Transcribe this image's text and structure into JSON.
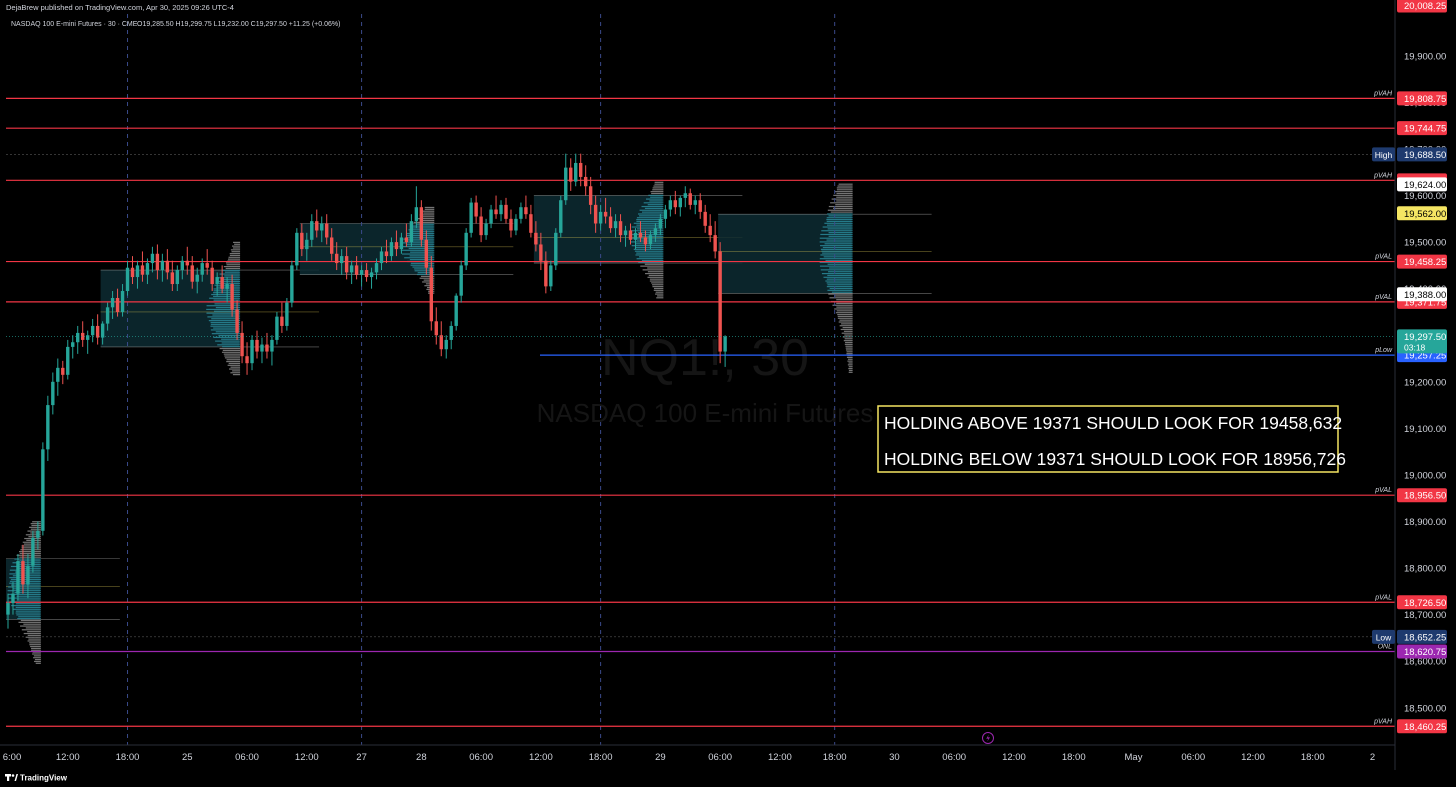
{
  "header": {
    "published_by": "DejaBrew published on TradingView.com, Apr 30, 2025 09:26 UTC-4",
    "symbol_line": "NASDAQ 100 E-mini Futures · 30 · CME",
    "ohlc": "O19,285.50  H19,299.75  L19,232.00  C19,297.50  +11.25 (+0.06%)"
  },
  "watermark": {
    "symbol": "NQ1!, 30",
    "name": "NASDAQ 100 E-mini Futures"
  },
  "annotation": {
    "line1": "HOLDING ABOVE 19371 SHOULD LOOK FOR 19458,632",
    "line2": "HOLDING BELOW 19371 SHOULD LOOK FOR 18956,726"
  },
  "footer": {
    "brand": "TradingView",
    "brand_icon": "tradingview-logo-icon"
  },
  "colors": {
    "background": "#000000",
    "level_red": "#f23645",
    "level_blue": "#2962ff",
    "level_purple": "#9c27b0",
    "candle_up": "#26a69a",
    "candle_down": "#ef5350",
    "profile_box": "#0d2b33",
    "annotation_border": "#f5e663",
    "last_price": "#26a69a"
  },
  "chart_data": {
    "type": "candlestick",
    "title": "NASDAQ 100 E-mini Futures · 30 · CME",
    "ylim": [
      18420,
      20020
    ],
    "y_ticks": [
      18500,
      18600,
      18700,
      18800,
      18900,
      19000,
      19100,
      19200,
      19300,
      19400,
      19500,
      19600,
      19700,
      19800,
      19900
    ],
    "y_tick_labels": [
      "18,500.00",
      "18,600.00",
      "18,700.00",
      "18,800.00",
      "18,900.00",
      "19,000.00",
      "19,100.00",
      "19,200.00",
      "19,300.00",
      "19,400.00",
      "19,500.00",
      "19,600.00",
      "19,700.00",
      "19,800.00",
      "19,900.00"
    ],
    "x_ticks": [
      {
        "label": "6:00",
        "bar": 0
      },
      {
        "label": "12:00",
        "bar": 12
      },
      {
        "label": "18:00",
        "bar": 24
      },
      {
        "label": "25",
        "bar": 36
      },
      {
        "label": "06:00",
        "bar": 48
      },
      {
        "label": "12:00",
        "bar": 60
      },
      {
        "label": "27",
        "bar": 71
      },
      {
        "label": "28",
        "bar": 83
      },
      {
        "label": "06:00",
        "bar": 95
      },
      {
        "label": "12:00",
        "bar": 107
      },
      {
        "label": "18:00",
        "bar": 119
      },
      {
        "label": "29",
        "bar": 131
      },
      {
        "label": "06:00",
        "bar": 143
      },
      {
        "label": "12:00",
        "bar": 155
      },
      {
        "label": "18:00",
        "bar": 166
      },
      {
        "label": "30",
        "bar": 178
      },
      {
        "label": "06:00",
        "bar": 190
      },
      {
        "label": "12:00",
        "bar": 202
      },
      {
        "label": "18:00",
        "bar": 214
      },
      {
        "label": "May",
        "bar": 226
      },
      {
        "label": "06:00",
        "bar": 238
      },
      {
        "label": "12:00",
        "bar": 250
      },
      {
        "label": "18:00",
        "bar": 262
      },
      {
        "label": "2",
        "bar": 274
      }
    ],
    "session_separators": [
      24,
      71,
      119,
      166
    ],
    "levels": [
      {
        "price": 19808.75,
        "label": "19,808.75",
        "tag": "pVAH",
        "kind": "red"
      },
      {
        "price": 19744.75,
        "label": "19,744.75",
        "tag": "",
        "kind": "red"
      },
      {
        "price": 19632.75,
        "label": "19,632.75",
        "tag": "pVAH",
        "kind": "red"
      },
      {
        "price": 19458.25,
        "label": "19,458.25",
        "tag": "pVAL",
        "kind": "red"
      },
      {
        "price": 19371.75,
        "label": "19,371.75",
        "tag": "pVAL",
        "kind": "red"
      },
      {
        "price": 19257.25,
        "label": "19,257.25",
        "tag": "pLow",
        "kind": "blue"
      },
      {
        "price": 18956.5,
        "label": "18,956.50",
        "tag": "pVAL",
        "kind": "red"
      },
      {
        "price": 18726.5,
        "label": "18,726.50",
        "tag": "pVAL",
        "kind": "red"
      },
      {
        "price": 18620.75,
        "label": "18,620.75",
        "tag": "ONL",
        "kind": "purple"
      },
      {
        "price": 18460.25,
        "label": "18,460.25",
        "tag": "pVAH",
        "kind": "red"
      }
    ],
    "price_tags": [
      {
        "price": 20008.25,
        "label": "20,008.25",
        "kind": "red"
      },
      {
        "price": 19688.5,
        "label": "19,688.50",
        "kind": "navy",
        "side_label": "High"
      },
      {
        "price": 19624.0,
        "label": "19,624.00",
        "kind": "white"
      },
      {
        "price": 19562.0,
        "label": "19,562.00",
        "kind": "yellow"
      },
      {
        "price": 19388.0,
        "label": "19,388.00",
        "kind": "white"
      },
      {
        "price": 18652.25,
        "label": "18,652.25",
        "kind": "navy",
        "side_label": "Low"
      }
    ],
    "last_price": {
      "price": 19297.5,
      "label": "19,297.50",
      "countdown": "03:18"
    },
    "profiles": [
      {
        "start": 0,
        "end": 6,
        "high": 18900,
        "low": 18595,
        "vah": 18820,
        "poc": 18760,
        "val": 18690
      },
      {
        "start": 19,
        "end": 46,
        "high": 19500,
        "low": 19215,
        "vah": 19440,
        "poc": 19350,
        "val": 19275
      },
      {
        "start": 59,
        "end": 85,
        "high": 19575,
        "low": 19390,
        "vah": 19540,
        "poc": 19490,
        "val": 19430
      },
      {
        "start": 106,
        "end": 131,
        "high": 19630,
        "low": 19380,
        "vah": 19600,
        "poc": 19510,
        "val": 19455
      },
      {
        "start": 143,
        "end": 169,
        "high": 19625,
        "low": 19220,
        "vah": 19560,
        "poc": 19480,
        "val": 19390
      }
    ],
    "candles": [
      [
        18700,
        18745,
        18670,
        18725
      ],
      [
        18725,
        18770,
        18700,
        18745
      ],
      [
        18745,
        18830,
        18730,
        18815
      ],
      [
        18815,
        18850,
        18745,
        18765
      ],
      [
        18765,
        18830,
        18735,
        18805
      ],
      [
        18805,
        18880,
        18790,
        18865
      ],
      [
        18865,
        18900,
        18840,
        18880
      ],
      [
        18880,
        19070,
        18870,
        19055
      ],
      [
        19055,
        19170,
        19030,
        19150
      ],
      [
        19150,
        19220,
        19130,
        19200
      ],
      [
        19200,
        19250,
        19170,
        19230
      ],
      [
        19230,
        19245,
        19195,
        19215
      ],
      [
        19215,
        19290,
        19205,
        19275
      ],
      [
        19275,
        19300,
        19250,
        19285
      ],
      [
        19285,
        19320,
        19260,
        19305
      ],
      [
        19305,
        19330,
        19275,
        19290
      ],
      [
        19290,
        19310,
        19260,
        19300
      ],
      [
        19300,
        19335,
        19285,
        19320
      ],
      [
        19320,
        19345,
        19280,
        19295
      ],
      [
        19295,
        19330,
        19280,
        19325
      ],
      [
        19325,
        19370,
        19310,
        19360
      ],
      [
        19360,
        19395,
        19335,
        19380
      ],
      [
        19380,
        19400,
        19340,
        19350
      ],
      [
        19350,
        19410,
        19340,
        19395
      ],
      [
        19395,
        19460,
        19385,
        19445
      ],
      [
        19445,
        19470,
        19410,
        19425
      ],
      [
        19425,
        19460,
        19400,
        19450
      ],
      [
        19450,
        19480,
        19415,
        19430
      ],
      [
        19430,
        19465,
        19410,
        19455
      ],
      [
        19455,
        19490,
        19435,
        19475
      ],
      [
        19475,
        19495,
        19420,
        19440
      ],
      [
        19440,
        19475,
        19415,
        19460
      ],
      [
        19460,
        19485,
        19420,
        19435
      ],
      [
        19435,
        19460,
        19395,
        19410
      ],
      [
        19410,
        19450,
        19395,
        19440
      ],
      [
        19440,
        19470,
        19420,
        19460
      ],
      [
        19460,
        19490,
        19430,
        19450
      ],
      [
        19450,
        19470,
        19400,
        19415
      ],
      [
        19415,
        19445,
        19390,
        19430
      ],
      [
        19430,
        19465,
        19415,
        19455
      ],
      [
        19455,
        19485,
        19430,
        19445
      ],
      [
        19445,
        19460,
        19395,
        19410
      ],
      [
        19410,
        19435,
        19385,
        19425
      ],
      [
        19425,
        19450,
        19390,
        19400
      ],
      [
        19400,
        19425,
        19370,
        19410
      ],
      [
        19410,
        19430,
        19340,
        19355
      ],
      [
        19355,
        19375,
        19290,
        19305
      ],
      [
        19305,
        19330,
        19240,
        19255
      ],
      [
        19255,
        19285,
        19215,
        19240
      ],
      [
        19240,
        19300,
        19225,
        19290
      ],
      [
        19290,
        19310,
        19250,
        19265
      ],
      [
        19265,
        19295,
        19240,
        19280
      ],
      [
        19280,
        19305,
        19250,
        19265
      ],
      [
        19265,
        19300,
        19235,
        19290
      ],
      [
        19290,
        19350,
        19280,
        19340
      ],
      [
        19340,
        19370,
        19305,
        19320
      ],
      [
        19320,
        19380,
        19310,
        19370
      ],
      [
        19370,
        19460,
        19360,
        19450
      ],
      [
        19450,
        19530,
        19440,
        19520
      ],
      [
        19520,
        19540,
        19470,
        19485
      ],
      [
        19485,
        19520,
        19460,
        19505
      ],
      [
        19505,
        19560,
        19490,
        19545
      ],
      [
        19545,
        19570,
        19510,
        19525
      ],
      [
        19525,
        19555,
        19500,
        19540
      ],
      [
        19540,
        19560,
        19495,
        19510
      ],
      [
        19510,
        19530,
        19460,
        19475
      ],
      [
        19475,
        19500,
        19440,
        19455
      ],
      [
        19455,
        19485,
        19430,
        19470
      ],
      [
        19470,
        19490,
        19420,
        19435
      ],
      [
        19435,
        19460,
        19410,
        19450
      ],
      [
        19450,
        19470,
        19420,
        19430
      ],
      [
        19430,
        19450,
        19405,
        19440
      ],
      [
        19440,
        19455,
        19415,
        19425
      ],
      [
        19425,
        19445,
        19400,
        19435
      ],
      [
        19435,
        19465,
        19420,
        19455
      ],
      [
        19455,
        19490,
        19440,
        19480
      ],
      [
        19480,
        19505,
        19455,
        19470
      ],
      [
        19470,
        19510,
        19460,
        19500
      ],
      [
        19500,
        19525,
        19470,
        19485
      ],
      [
        19485,
        19520,
        19475,
        19510
      ],
      [
        19510,
        19540,
        19490,
        19500
      ],
      [
        19500,
        19560,
        19490,
        19545
      ],
      [
        19545,
        19620,
        19530,
        19575
      ],
      [
        19575,
        19590,
        19490,
        19505
      ],
      [
        19505,
        19525,
        19430,
        19445
      ],
      [
        19445,
        19470,
        19310,
        19330
      ],
      [
        19330,
        19360,
        19280,
        19300
      ],
      [
        19300,
        19330,
        19255,
        19270
      ],
      [
        19270,
        19300,
        19250,
        19290
      ],
      [
        19290,
        19330,
        19270,
        19320
      ],
      [
        19320,
        19390,
        19310,
        19385
      ],
      [
        19385,
        19460,
        19370,
        19450
      ],
      [
        19450,
        19530,
        19440,
        19520
      ],
      [
        19520,
        19595,
        19510,
        19585
      ],
      [
        19585,
        19600,
        19540,
        19555
      ],
      [
        19555,
        19575,
        19500,
        19515
      ],
      [
        19515,
        19550,
        19505,
        19540
      ],
      [
        19540,
        19580,
        19530,
        19570
      ],
      [
        19570,
        19600,
        19550,
        19560
      ],
      [
        19560,
        19590,
        19545,
        19580
      ],
      [
        19580,
        19595,
        19540,
        19550
      ],
      [
        19550,
        19570,
        19510,
        19525
      ],
      [
        19525,
        19560,
        19515,
        19550
      ],
      [
        19550,
        19585,
        19540,
        19575
      ],
      [
        19575,
        19600,
        19550,
        19560
      ],
      [
        19560,
        19580,
        19510,
        19520
      ],
      [
        19520,
        19545,
        19480,
        19495
      ],
      [
        19495,
        19520,
        19440,
        19460
      ],
      [
        19460,
        19480,
        19390,
        19405
      ],
      [
        19405,
        19460,
        19395,
        19450
      ],
      [
        19450,
        19530,
        19440,
        19520
      ],
      [
        19520,
        19600,
        19510,
        19590
      ],
      [
        19590,
        19690,
        19580,
        19660
      ],
      [
        19660,
        19680,
        19610,
        19630
      ],
      [
        19630,
        19690,
        19620,
        19670
      ],
      [
        19670,
        19690,
        19620,
        19640
      ],
      [
        19640,
        19665,
        19600,
        19620
      ],
      [
        19620,
        19640,
        19560,
        19580
      ],
      [
        19580,
        19600,
        19520,
        19540
      ],
      [
        19540,
        19580,
        19525,
        19565
      ],
      [
        19565,
        19595,
        19540,
        19555
      ],
      [
        19555,
        19575,
        19520,
        19530
      ],
      [
        19530,
        19560,
        19510,
        19545
      ],
      [
        19545,
        19560,
        19500,
        19515
      ],
      [
        19515,
        19535,
        19490,
        19525
      ],
      [
        19525,
        19540,
        19495,
        19505
      ],
      [
        19505,
        19530,
        19485,
        19520
      ],
      [
        19520,
        19545,
        19500,
        19510
      ],
      [
        19510,
        19525,
        19480,
        19495
      ],
      [
        19495,
        19525,
        19485,
        19515
      ],
      [
        19515,
        19540,
        19500,
        19530
      ],
      [
        19530,
        19560,
        19515,
        19550
      ],
      [
        19550,
        19580,
        19530,
        19570
      ],
      [
        19570,
        19600,
        19555,
        19590
      ],
      [
        19590,
        19610,
        19560,
        19575
      ],
      [
        19575,
        19600,
        19555,
        19595
      ],
      [
        19595,
        19620,
        19575,
        19605
      ],
      [
        19605,
        19615,
        19570,
        19580
      ],
      [
        19580,
        19600,
        19560,
        19590
      ],
      [
        19590,
        19605,
        19550,
        19565
      ],
      [
        19565,
        19580,
        19520,
        19535
      ],
      [
        19535,
        19560,
        19500,
        19515
      ],
      [
        19515,
        19545,
        19465,
        19480
      ],
      [
        19480,
        19500,
        19240,
        19265
      ],
      [
        19265,
        19300,
        19232,
        19297.5
      ]
    ]
  }
}
